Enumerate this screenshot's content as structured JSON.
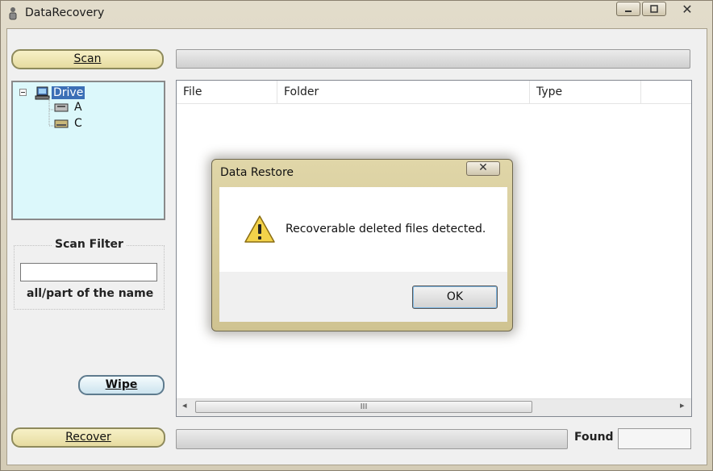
{
  "window": {
    "title": "DataRecovery",
    "controls": {
      "close": "✕"
    }
  },
  "buttons": {
    "scan": "Scan",
    "wipe": "Wipe",
    "recover": "Recover"
  },
  "tree": {
    "root": "Drive",
    "children": [
      "A",
      "C"
    ]
  },
  "filter": {
    "title": "Scan Filter",
    "value": "",
    "hint": "all/part of the name"
  },
  "list": {
    "columns": [
      "File",
      "Folder",
      "Type"
    ],
    "scroll_grip": "III"
  },
  "status": {
    "found_label": "Found",
    "found_value": ""
  },
  "dialog": {
    "title": "Data Restore",
    "close": "✕",
    "message": "Recoverable deleted files detected.",
    "ok": "OK"
  },
  "icons": {
    "app": "app-icon",
    "tree_root": "computer-icon",
    "tree_child": "drive-icon",
    "dialog": "warning-icon"
  }
}
